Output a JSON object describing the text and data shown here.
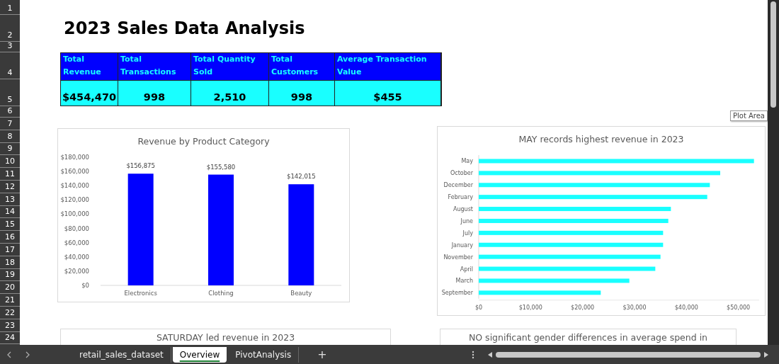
{
  "rows": [
    "1",
    "2",
    "3",
    "4",
    "5",
    "6",
    "7",
    "8",
    "9",
    "10",
    "11",
    "12",
    "13",
    "14",
    "15",
    "16",
    "17",
    "18",
    "19",
    "20",
    "21",
    "22",
    "23",
    "24"
  ],
  "title": "2023 Sales Data Analysis",
  "kpis": [
    {
      "label": "Total Revenue",
      "value": "$454,470"
    },
    {
      "label": "Total Transactions",
      "value": "998"
    },
    {
      "label": "Total Quantity Sold",
      "value": "2,510"
    },
    {
      "label": "Total Customers",
      "value": "998"
    },
    {
      "label": "Average Transaction Value",
      "value": "$455"
    }
  ],
  "category_chart": {
    "chart_data": {
      "type": "bar",
      "title": "Revenue by Product Category",
      "categories": [
        "Electronics",
        "Clothing",
        "Beauty"
      ],
      "series": [
        {
          "color": "#0000ff",
          "values": [
            156875,
            155580,
            142015
          ]
        }
      ],
      "ylim": [
        0,
        180000
      ],
      "yticks": [
        {
          "value": 0,
          "label": "$0"
        },
        {
          "value": 20000,
          "label": "$20,000"
        },
        {
          "value": 40000,
          "label": "$40,000"
        },
        {
          "value": 60000,
          "label": "$60,000"
        },
        {
          "value": 80000,
          "label": "$80,000"
        },
        {
          "value": 100000,
          "label": "$100,000"
        },
        {
          "value": 120000,
          "label": "$120,000"
        },
        {
          "value": 140000,
          "label": "$140,000"
        },
        {
          "value": 160000,
          "label": "$160,000"
        },
        {
          "value": 180000,
          "label": "$180,000"
        }
      ],
      "value_labels": [
        "$156,875",
        "$155,580",
        "$142,015"
      ]
    }
  },
  "month_chart": {
    "chart_data": {
      "type": "bar",
      "orientation": "horizontal",
      "title": "MAY records highest revenue in 2023",
      "categories": [
        "May",
        "October",
        "December",
        "February",
        "August",
        "June",
        "July",
        "January",
        "November",
        "April",
        "March",
        "September"
      ],
      "series": [
        {
          "color": "#19ffff",
          "values": [
            53000,
            46500,
            44500,
            44000,
            37000,
            36500,
            35500,
            35500,
            35000,
            34000,
            29000,
            23500
          ]
        }
      ],
      "xlim": [
        0,
        54000
      ],
      "xticks": [
        {
          "value": 0,
          "label": "$0"
        },
        {
          "value": 10000,
          "label": "$10,000"
        },
        {
          "value": 20000,
          "label": "$20,000"
        },
        {
          "value": 30000,
          "label": "$30,000"
        },
        {
          "value": 40000,
          "label": "$40,000"
        },
        {
          "value": 50000,
          "label": "$50,000"
        }
      ]
    }
  },
  "lower_charts": [
    {
      "title": "SATURDAY led revenue in 2023"
    },
    {
      "title": "NO significant gender differences in average spend in"
    }
  ],
  "tooltip": "Plot Area",
  "sheet_tabs": [
    {
      "label": "retail_sales_dataset",
      "selected": false
    },
    {
      "label": "Overview",
      "selected": true
    },
    {
      "label": "PivotAnalysis",
      "selected": false
    }
  ],
  "add_sheet": "+"
}
